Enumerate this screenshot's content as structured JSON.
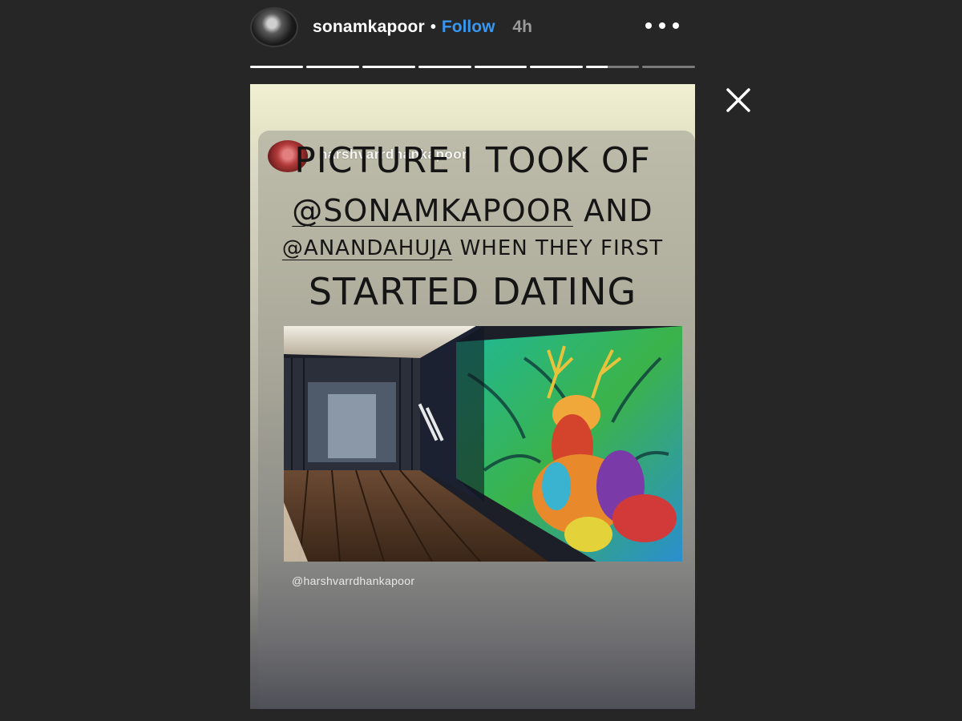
{
  "header": {
    "username": "sonamkapoor",
    "separator": "•",
    "follow_label": "Follow",
    "time": "4h",
    "more_icon": "more-dots-icon",
    "avatar_icon": "avatar"
  },
  "progress": {
    "segments": 8,
    "completed": 6,
    "current_fraction": 0.4,
    "active_color": "#ffffff",
    "inactive_color": "#7a7a7a"
  },
  "close": {
    "icon": "close-icon"
  },
  "story": {
    "shared_from_username": "harshvarrdhankapoor",
    "caption": {
      "line1": "PICTURE I TOOK OF",
      "line2_mention": "@SONAMKAPOOR",
      "line2_rest": " AND",
      "line3_mention": "@ANANDAHUJA",
      "line3_rest": " WHEN THEY FIRST",
      "line4": "STARTED DATING"
    },
    "photo_credit": "@harshvarrdhankapoor"
  },
  "colors": {
    "background": "#262626",
    "follow": "#3897f0",
    "caption_text": "#151515"
  }
}
